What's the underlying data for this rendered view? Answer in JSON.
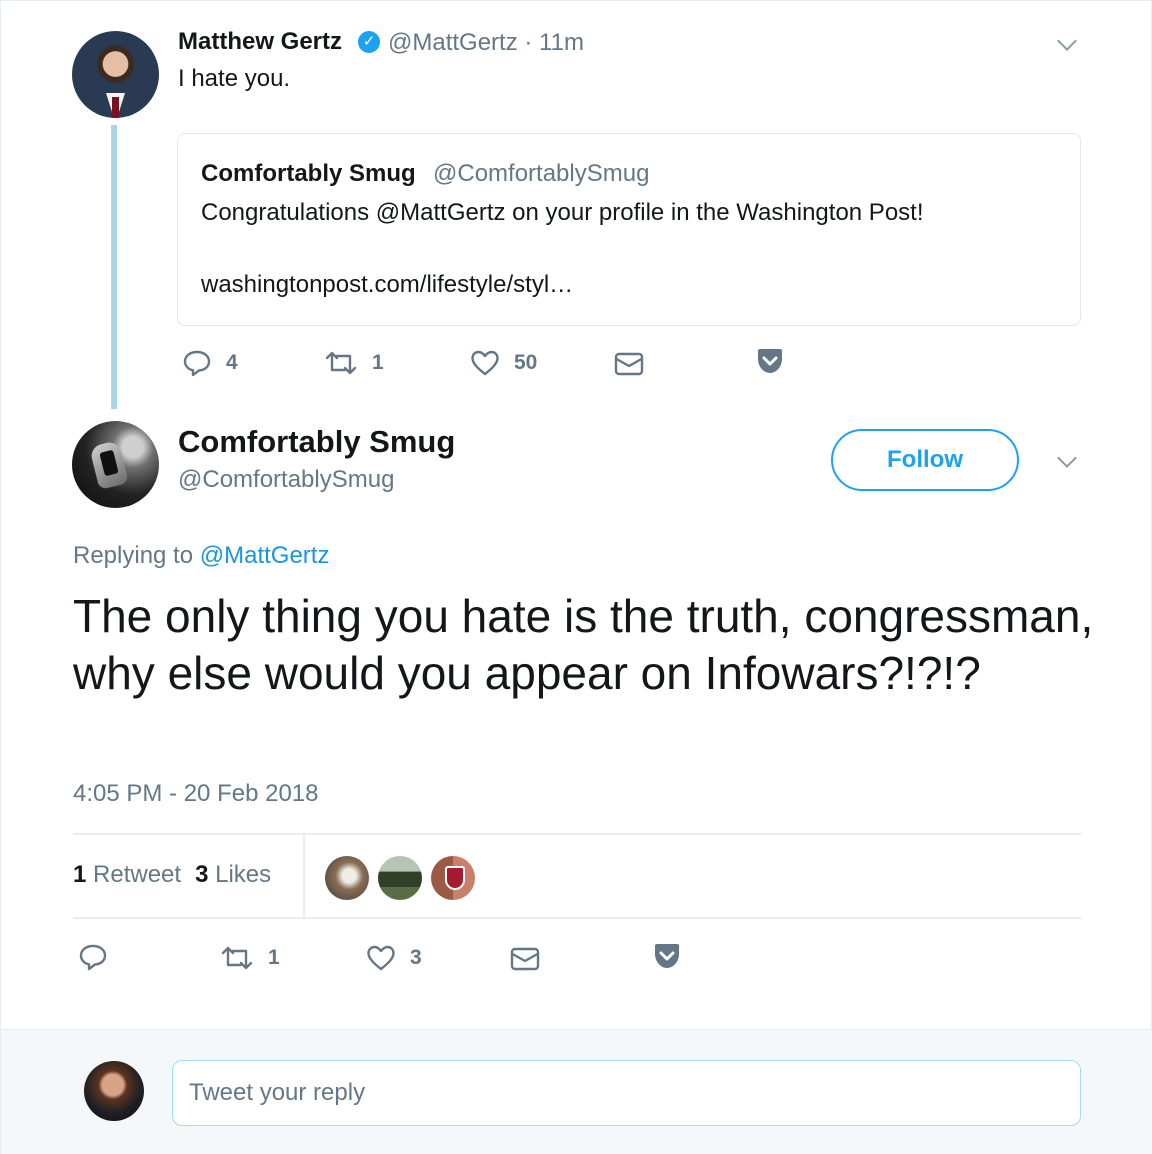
{
  "parent_tweet": {
    "name": "Matthew Gertz",
    "verified": true,
    "handle_time": "@MattGertz · 11m",
    "text": "I hate you.",
    "quoted": {
      "name": "Comfortably Smug",
      "handle": "@ComfortablySmug",
      "text": "Congratulations @MattGertz on your profile in the Washington Post!",
      "link": "washingtonpost.com/lifestyle/styl…"
    },
    "actions": {
      "replies": "4",
      "retweets": "1",
      "likes": "50"
    }
  },
  "main_tweet": {
    "name": "Comfortably Smug",
    "handle": "@ComfortablySmug",
    "follow_label": "Follow",
    "replying_prefix": "Replying to",
    "replying_to": "@MattGertz",
    "text": "The only thing you hate is the truth, congressman, why else would you appear on Infowars?!?!?",
    "timestamp": "4:05 PM - 20 Feb 2018",
    "stats": {
      "retweet_count": "1",
      "retweet_label": "Retweet",
      "like_count": "3",
      "like_label": "Likes"
    },
    "actions": {
      "replies": "",
      "retweets": "1",
      "likes": "3"
    }
  },
  "composer": {
    "placeholder": "Tweet your reply"
  },
  "icons": [
    "verified-badge-icon",
    "chevron-down-icon",
    "reply-icon",
    "retweet-icon",
    "like-icon",
    "direct-message-icon",
    "pocket-save-icon"
  ],
  "colors": {
    "accent": "#1da1f2",
    "mention": "#1b95e0",
    "muted": "#657786",
    "thread_line": "#a9d4ea"
  }
}
